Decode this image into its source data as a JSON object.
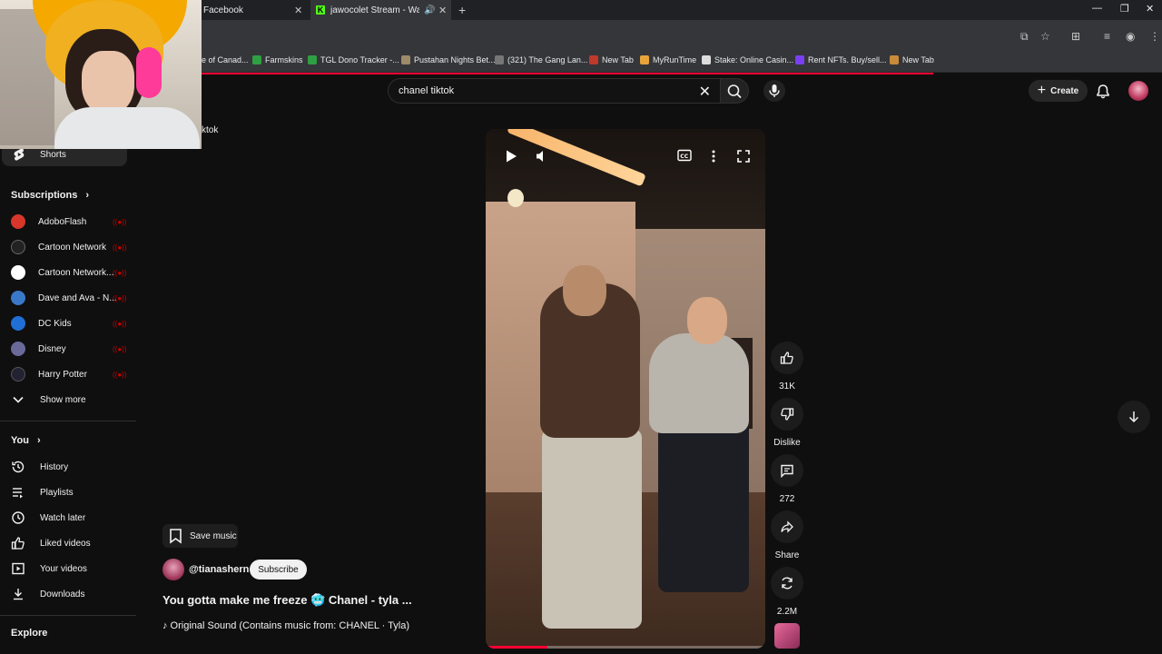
{
  "browser": {
    "tabs": [
      {
        "title": "Facebook",
        "active": false
      },
      {
        "title": "jawocolet Stream - Watch l",
        "active": true
      }
    ],
    "new_tab_symbol": "+",
    "bookmarks": [
      {
        "label": "e of Canad...",
        "color": "#c0392b"
      },
      {
        "label": "Farmskins",
        "color": "#2ea043"
      },
      {
        "label": "TGL Dono Tracker -...",
        "color": "#2ea043"
      },
      {
        "label": "Pustahan Nights Bet...",
        "color": "#9c8b6a"
      },
      {
        "label": "(321) The Gang Lan...",
        "color": "#777777"
      },
      {
        "label": "New Tab",
        "color": "#c0392b"
      },
      {
        "label": "MyRunTime",
        "color": "#e8a43a"
      },
      {
        "label": "Stake: Online Casin...",
        "color": "#dddddd"
      },
      {
        "label": "Rent NFTs. Buy/sell...",
        "color": "#7b3ff2"
      },
      {
        "label": "New Tab",
        "color": "#c98b3a"
      }
    ]
  },
  "header": {
    "search_value": "chanel tiktok",
    "create_label": "Create"
  },
  "sidebar": {
    "partial_text": "ktok",
    "shorts_label": "Shorts",
    "subscriptions_heading": "Subscriptions",
    "subscriptions": [
      {
        "label": "AdoboFlash",
        "color": "#d7362b"
      },
      {
        "label": "Cartoon Network",
        "color": "#222222"
      },
      {
        "label": "Cartoon Network...",
        "color": "#ffffff"
      },
      {
        "label": "Dave and Ava - N...",
        "color": "#3a78c9"
      },
      {
        "label": "DC Kids",
        "color": "#1f6fd6"
      },
      {
        "label": "Disney",
        "color": "#6a6a9a"
      },
      {
        "label": "Harry Potter",
        "color": "#222233"
      }
    ],
    "show_more_label": "Show more",
    "you_heading": "You",
    "you_items": [
      {
        "label": "History",
        "icon": "history-icon"
      },
      {
        "label": "Playlists",
        "icon": "playlists-icon"
      },
      {
        "label": "Watch later",
        "icon": "watch-later-icon"
      },
      {
        "label": "Liked videos",
        "icon": "thumb-up-icon"
      },
      {
        "label": "Your videos",
        "icon": "your-videos-icon"
      },
      {
        "label": "Downloads",
        "icon": "download-icon"
      }
    ],
    "explore_heading": "Explore"
  },
  "video": {
    "save_music_label": "Save music",
    "channel_handle": "@tianashern",
    "subscribe_label": "Subscribe",
    "title": "You gotta make me freeze 🥶 Chanel - tyla ...",
    "music": "♪ Original Sound (Contains music from: CHANEL · Tyla)",
    "progress": 0.22
  },
  "actions": {
    "like_count": "31K",
    "dislike_label": "Dislike",
    "comment_count": "272",
    "share_label": "Share",
    "remix_count": "2.2M"
  },
  "colors": {
    "accent": "#ff0033",
    "background": "#0f0f0f"
  }
}
